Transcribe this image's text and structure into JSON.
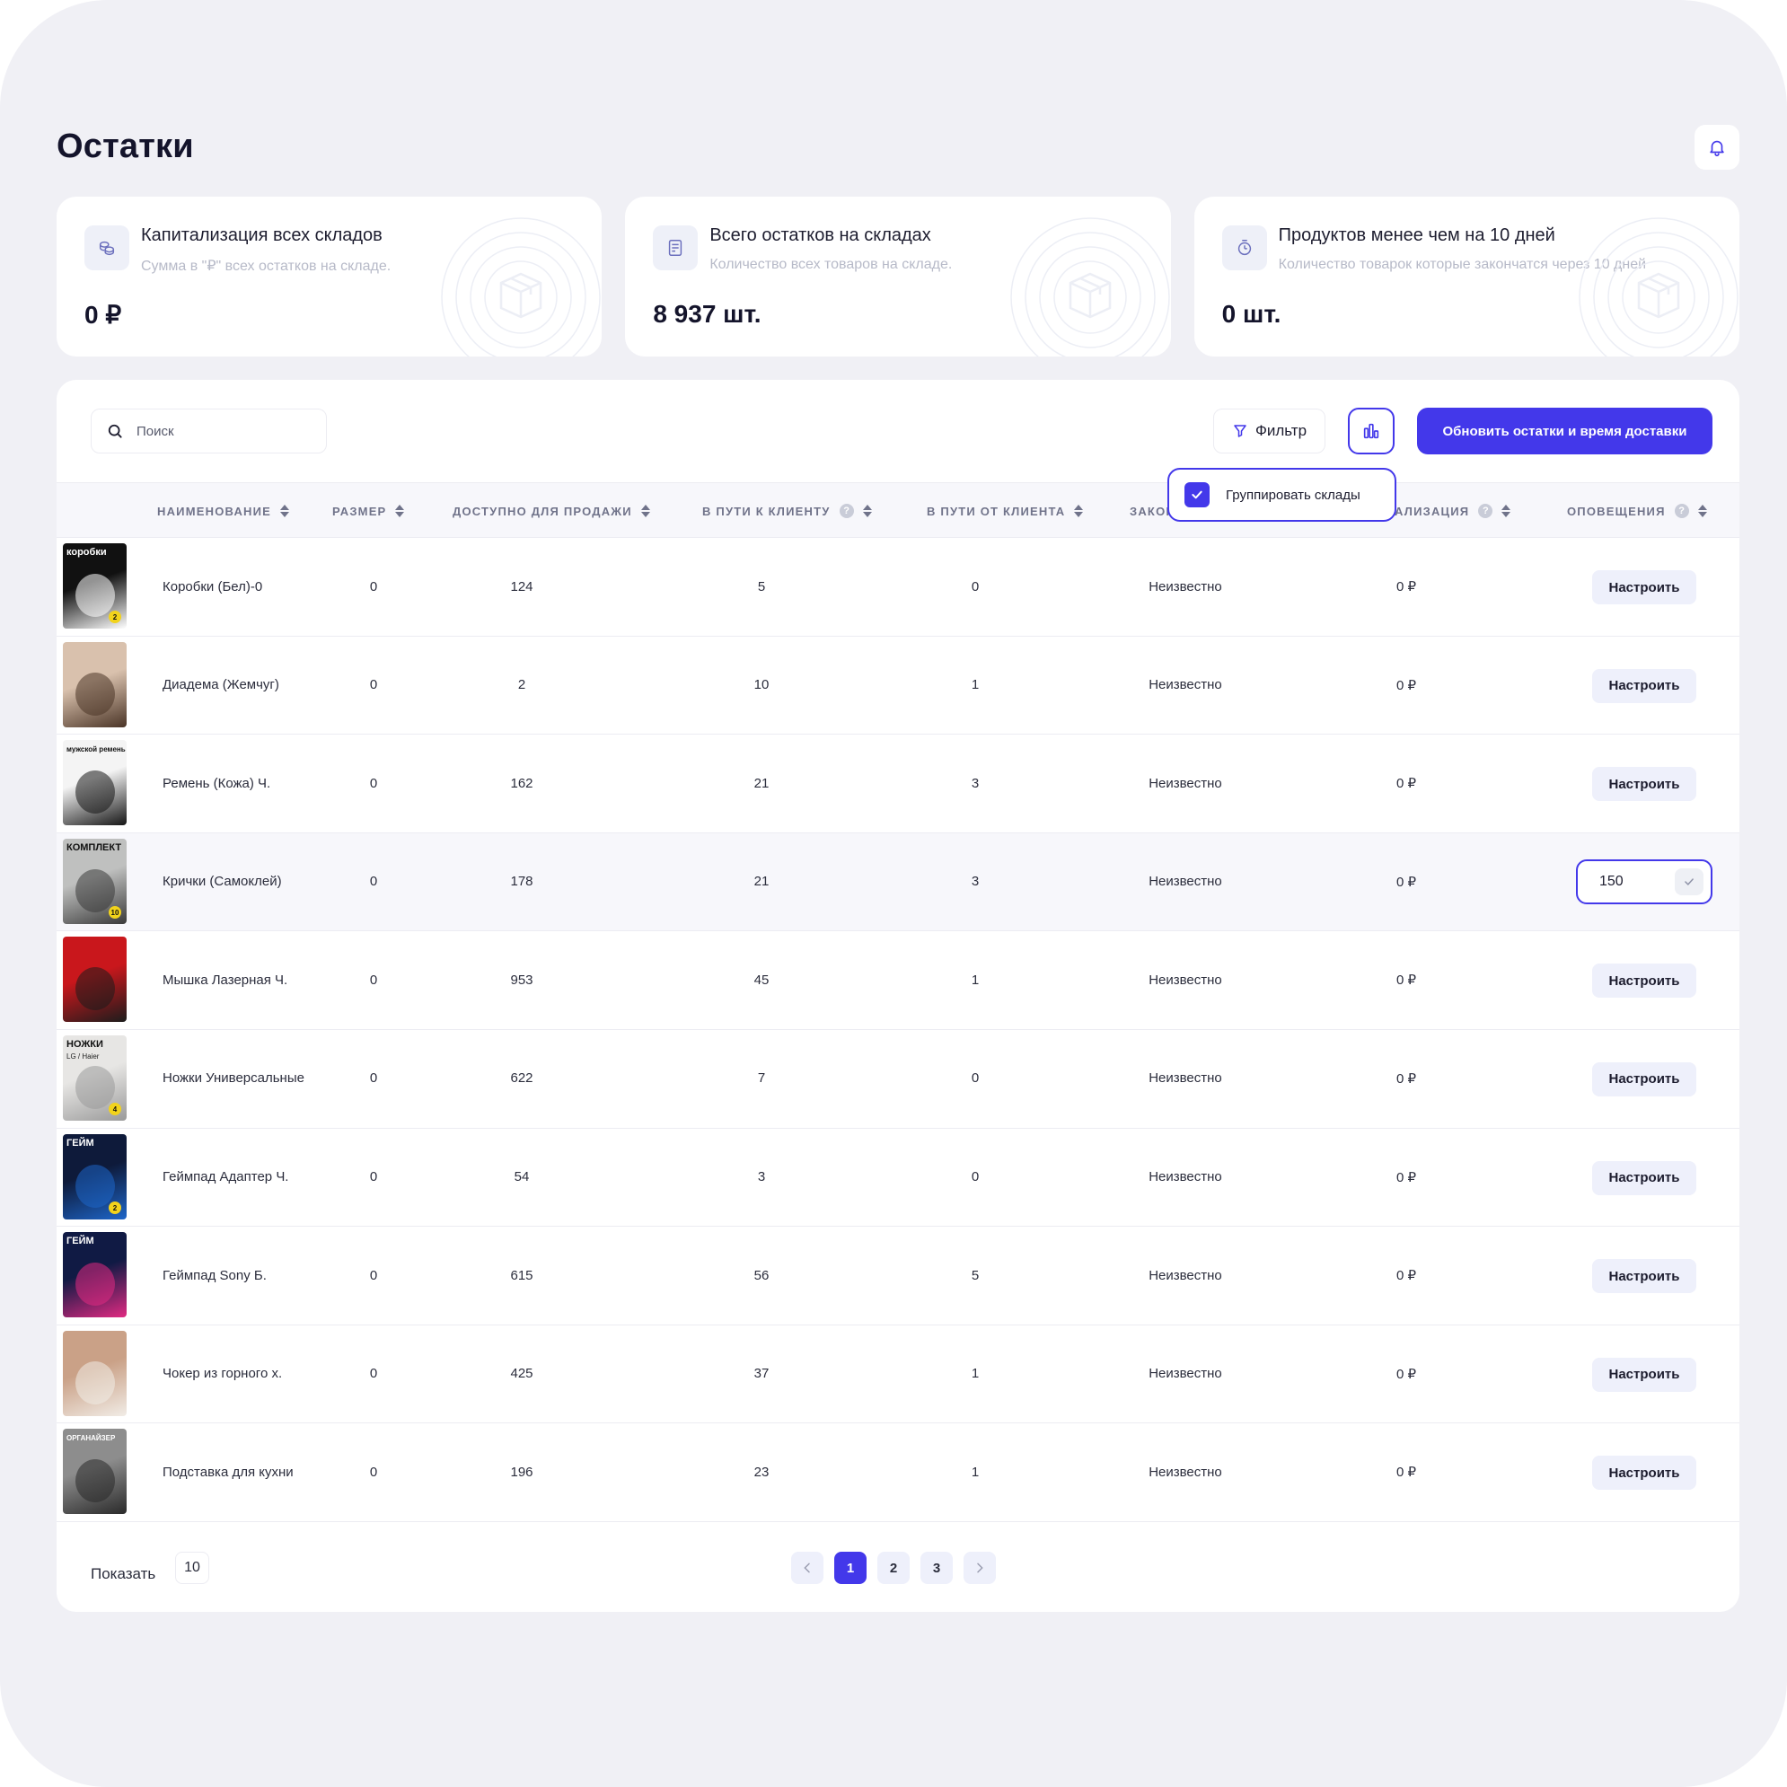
{
  "page": {
    "title": "Остатки"
  },
  "cards": [
    {
      "title": "Капитализация всех складов",
      "subtitle": "Сумма в \"₽\" всех остатков на складе.",
      "value": "0 ₽",
      "icon": "coins-icon"
    },
    {
      "title": "Всего остатков на складах",
      "subtitle": "Количество всех товаров на складе.",
      "value": "8 937 шт.",
      "icon": "document-icon"
    },
    {
      "title": "Продуктов менее чем на 10 дней",
      "subtitle": "Количество товарок которые закончатся через 10 дней",
      "value": "0 шт.",
      "icon": "pie-clock-icon"
    }
  ],
  "toolbar": {
    "search_placeholder": "Поиск",
    "filter_label": "Фильтр",
    "update_label": "Обновить остатки и время доставки"
  },
  "dropdown": {
    "group_label": "Группировать склады",
    "checked": true
  },
  "table": {
    "headers": {
      "name": "Наименование",
      "size": "Размер",
      "available": "Доступно для продажи",
      "to_client": "В пути к клиенту",
      "from_client": "В пути от клиента",
      "ends": "Закон",
      "capitalization": "ализация",
      "notifications": "Оповещения"
    },
    "setup_label": "Настроить",
    "rows": [
      {
        "name": "Коробки (Бел)-0",
        "size": "0",
        "available": "124",
        "to_client": "5",
        "from_client": "0",
        "ends": "Неизвестно",
        "capitalization": "0 ₽"
      },
      {
        "name": "Диадема (Жемчуг)",
        "size": "0",
        "available": "2",
        "to_client": "10",
        "from_client": "1",
        "ends": "Неизвестно",
        "capitalization": "0 ₽"
      },
      {
        "name": "Ремень (Кожа) Ч.",
        "size": "0",
        "available": "162",
        "to_client": "21",
        "from_client": "3",
        "ends": "Неизвестно",
        "capitalization": "0 ₽"
      },
      {
        "name": "Крички (Самоклей)",
        "size": "0",
        "available": "178",
        "to_client": "21",
        "from_client": "3",
        "ends": "Неизвестно",
        "capitalization": "0 ₽",
        "notify_value": "150"
      },
      {
        "name": "Мышка Лазерная Ч.",
        "size": "0",
        "available": "953",
        "to_client": "45",
        "from_client": "1",
        "ends": "Неизвестно",
        "capitalization": "0 ₽"
      },
      {
        "name": "Ножки Универсальные",
        "size": "0",
        "available": "622",
        "to_client": "7",
        "from_client": "0",
        "ends": "Неизвестно",
        "capitalization": "0 ₽"
      },
      {
        "name": "Геймпад Адаптер Ч.",
        "size": "0",
        "available": "54",
        "to_client": "3",
        "from_client": "0",
        "ends": "Неизвестно",
        "capitalization": "0 ₽"
      },
      {
        "name": "Геймпад Sony Б.",
        "size": "0",
        "available": "615",
        "to_client": "56",
        "from_client": "5",
        "ends": "Неизвестно",
        "capitalization": "0 ₽"
      },
      {
        "name": "Чокер из горного х.",
        "size": "0",
        "available": "425",
        "to_client": "37",
        "from_client": "1",
        "ends": "Неизвестно",
        "capitalization": "0 ₽"
      },
      {
        "name": "Подставка для кухни",
        "size": "0",
        "available": "196",
        "to_client": "23",
        "from_client": "1",
        "ends": "Неизвестно",
        "capitalization": "0 ₽"
      }
    ],
    "thumbnails": [
      {
        "label": "коробки",
        "badge": "2",
        "colors": [
          "#111111",
          "#ffffff"
        ]
      },
      {
        "colors": [
          "#d9c1ad",
          "#4a3426"
        ]
      },
      {
        "label": "мужской ремень",
        "colors": [
          "#f4f4f4",
          "#151515"
        ]
      },
      {
        "label": "КОМПЛЕКТ",
        "badge": "10",
        "colors": [
          "#bfc0bf",
          "#3a3a3a"
        ]
      },
      {
        "colors": [
          "#c9171c",
          "#1c1c1c"
        ]
      },
      {
        "label": "НОЖКИ",
        "sublabel": "LG / Haier",
        "badge": "4",
        "colors": [
          "#e7e6e4",
          "#9a9a9a"
        ]
      },
      {
        "label": "ГЕЙМ",
        "badge": "2",
        "colors": [
          "#0e1a3a",
          "#1e66c9"
        ]
      },
      {
        "label": "ГЕЙМ",
        "colors": [
          "#101a44",
          "#e12a82"
        ]
      },
      {
        "colors": [
          "#caa187",
          "#f1ece6"
        ]
      },
      {
        "label": "ОРГАНАЙЗЕР",
        "colors": [
          "#8d8d8d",
          "#2a2a2a"
        ]
      }
    ]
  },
  "footer": {
    "show_label": "Показать",
    "show_value": "10",
    "pages": [
      "1",
      "2",
      "3"
    ],
    "active_page": "1"
  },
  "colors": {
    "accent": "#4338ea",
    "background": "#f0f0f5",
    "muted": "#b7bac8"
  }
}
